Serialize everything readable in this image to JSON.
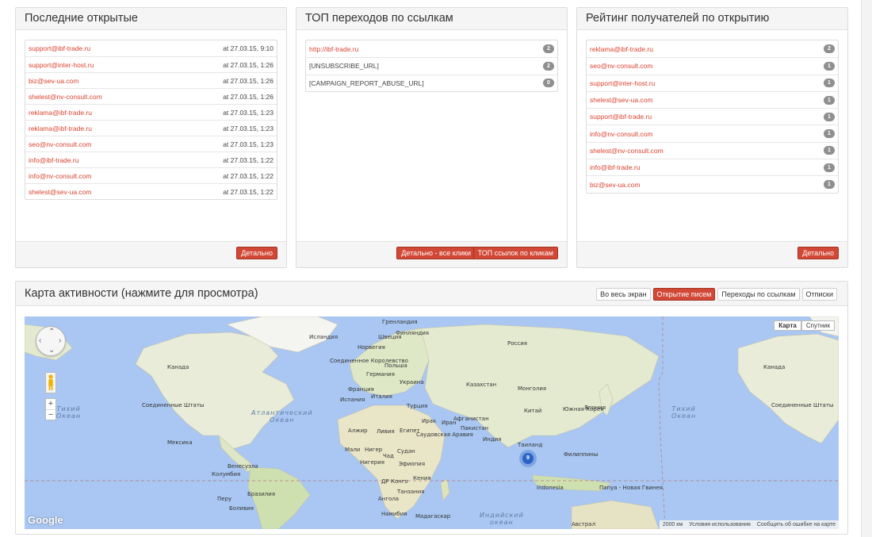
{
  "recent": {
    "title": "Последние открытые",
    "rows": [
      {
        "email": "support@ibf-trade.ru",
        "time": "at 27.03.15, 9:10"
      },
      {
        "email": "support@inter-host.ru",
        "time": "at 27.03.15, 1:26"
      },
      {
        "email": "biz@sev-ua.com",
        "time": "at 27.03.15, 1:26"
      },
      {
        "email": "shelest@nv-consult.com",
        "time": "at 27.03.15, 1:26"
      },
      {
        "email": "reklama@ibf-trade.ru",
        "time": "at 27.03.15, 1:23"
      },
      {
        "email": "reklama@ibf-trade.ru",
        "time": "at 27.03.15, 1:23"
      },
      {
        "email": "seo@nv-consult.com",
        "time": "at 27.03.15, 1:23"
      },
      {
        "email": "info@ibf-trade.ru",
        "time": "at 27.03.15, 1:22"
      },
      {
        "email": "info@nv-consult.com",
        "time": "at 27.03.15, 1:22"
      },
      {
        "email": "shelest@sev-ua.com",
        "time": "at 27.03.15, 1:22"
      }
    ],
    "details_label": "Детально"
  },
  "toplinks": {
    "title": "ТОП переходов по ссылкам",
    "rows": [
      {
        "url": "http://ibf-trade.ru",
        "count": "2",
        "is_link": true
      },
      {
        "url": "[UNSUBSCRIBE_URL]",
        "count": "2",
        "is_link": false
      },
      {
        "url": "[CAMPAIGN_REPORT_ABUSE_URL]",
        "count": "0",
        "is_link": false
      }
    ],
    "details_all_label": "Детально - все клики",
    "top_clicks_label": "ТОП ссылок по кликам"
  },
  "rating": {
    "title": "Рейтинг получателей по открытию",
    "rows": [
      {
        "email": "reklama@ibf-trade.ru",
        "count": "2"
      },
      {
        "email": "seo@nv-consult.com",
        "count": "1"
      },
      {
        "email": "support@inter-host.ru",
        "count": "1"
      },
      {
        "email": "shelest@sev-ua.com",
        "count": "1"
      },
      {
        "email": "support@ibf-trade.ru",
        "count": "1"
      },
      {
        "email": "info@nv-consult.com",
        "count": "1"
      },
      {
        "email": "shelest@nv-consult.com",
        "count": "1"
      },
      {
        "email": "info@ibf-trade.ru",
        "count": "1"
      },
      {
        "email": "biz@sev-ua.com",
        "count": "1"
      }
    ],
    "details_label": "Детально"
  },
  "activity": {
    "title": "Карта активности (нажмите для просмотра)",
    "tabs": [
      "Во весь экран",
      "Открытие писем",
      "Переходы по ссылкам",
      "Отписки"
    ],
    "active_tab": 1
  },
  "map": {
    "type_map": "Карта",
    "type_satellite": "Спутник",
    "cluster_count": "9",
    "logo": "Google",
    "scale": "2000 км",
    "terms": "Условия использования",
    "report": "Сообщить об ошибке на карте",
    "labels": {
      "greenland": "Гренландия",
      "iceland": "Исландия",
      "norway": "Норвегия",
      "sweden": "Швеция",
      "finland": "Финляндия",
      "russia": "Россия",
      "uk": "Соединенное Королевство",
      "germany": "Германия",
      "poland": "Польша",
      "france": "Франция",
      "ukraine": "Украина",
      "spain": "Испания",
      "italy": "Италия",
      "kazakhstan": "Казахстан",
      "mongolia": "Монголия",
      "turkey": "Турция",
      "china": "Китай",
      "korea": "Южная Корея",
      "japan": "Япония",
      "afghanistan": "Афганистан",
      "iraq": "Ирак",
      "iran": "Иран",
      "pakistan": "Пакистан",
      "algeria": "Алжир",
      "libya": "Ливия",
      "egypt": "Египет",
      "saudi": "Саудовская Аравия",
      "india": "Индия",
      "thailand": "Таиланд",
      "mali": "Мали",
      "niger": "Нигер",
      "chad": "Чад",
      "sudan": "Судан",
      "nigeria": "Нигерия",
      "ethiopia": "Эфиопия",
      "kenya": "Кения",
      "drc": "ДР Конго",
      "tanzania": "Танзания",
      "angola": "Ангола",
      "namibia": "Намибия",
      "madagascar": "Мадагаскар",
      "indonesia": "Indonesia",
      "png": "Папуа - Новая Гвинея",
      "australia": "Австрал",
      "canada": "Канада",
      "canada2": "Канада",
      "usa": "Соединенные Штаты",
      "usa2": "Соединенные Штаты",
      "mexico": "Мексика",
      "venezuela": "Венесуэла",
      "colombia": "Колумбия",
      "peru": "Перу",
      "brazil": "Бразилия",
      "bolivia": "Боливия",
      "philippines": "Филиппины",
      "ocean_pacific": "Тихий\nОкеан",
      "ocean_pacific2": "Тихий\nОкеан",
      "ocean_atlantic": "Атлантический\nОкеан",
      "ocean_indian": "Индийский\nокеан"
    }
  }
}
